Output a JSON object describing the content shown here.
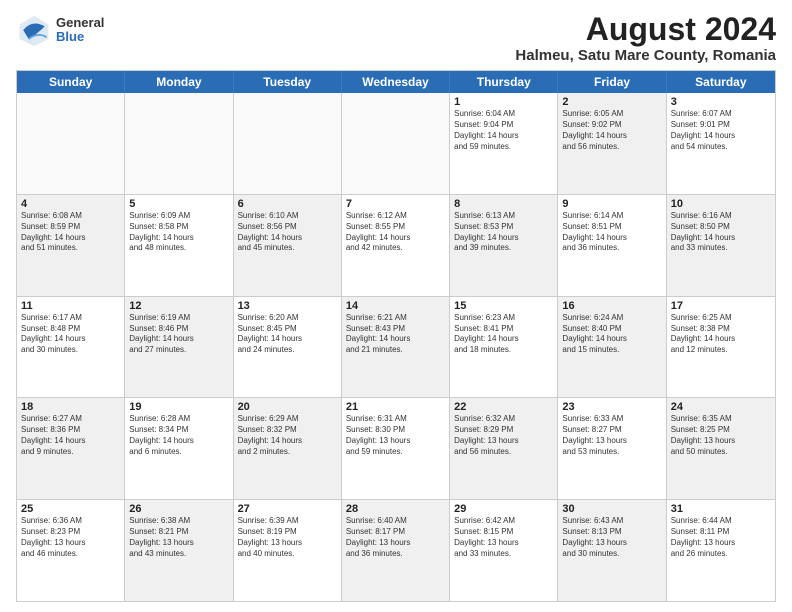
{
  "header": {
    "logo": {
      "general": "General",
      "blue": "Blue"
    },
    "title": "August 2024",
    "subtitle": "Halmeu, Satu Mare County, Romania"
  },
  "calendar": {
    "days_of_week": [
      "Sunday",
      "Monday",
      "Tuesday",
      "Wednesday",
      "Thursday",
      "Friday",
      "Saturday"
    ],
    "rows": [
      [
        {
          "day": "",
          "info": "",
          "shaded": false,
          "empty": true
        },
        {
          "day": "",
          "info": "",
          "shaded": false,
          "empty": true
        },
        {
          "day": "",
          "info": "",
          "shaded": false,
          "empty": true
        },
        {
          "day": "",
          "info": "",
          "shaded": false,
          "empty": true
        },
        {
          "day": "1",
          "info": "Sunrise: 6:04 AM\nSunset: 9:04 PM\nDaylight: 14 hours\nand 59 minutes.",
          "shaded": false,
          "empty": false
        },
        {
          "day": "2",
          "info": "Sunrise: 6:05 AM\nSunset: 9:02 PM\nDaylight: 14 hours\nand 56 minutes.",
          "shaded": true,
          "empty": false
        },
        {
          "day": "3",
          "info": "Sunrise: 6:07 AM\nSunset: 9:01 PM\nDaylight: 14 hours\nand 54 minutes.",
          "shaded": false,
          "empty": false
        }
      ],
      [
        {
          "day": "4",
          "info": "Sunrise: 6:08 AM\nSunset: 8:59 PM\nDaylight: 14 hours\nand 51 minutes.",
          "shaded": true,
          "empty": false
        },
        {
          "day": "5",
          "info": "Sunrise: 6:09 AM\nSunset: 8:58 PM\nDaylight: 14 hours\nand 48 minutes.",
          "shaded": false,
          "empty": false
        },
        {
          "day": "6",
          "info": "Sunrise: 6:10 AM\nSunset: 8:56 PM\nDaylight: 14 hours\nand 45 minutes.",
          "shaded": true,
          "empty": false
        },
        {
          "day": "7",
          "info": "Sunrise: 6:12 AM\nSunset: 8:55 PM\nDaylight: 14 hours\nand 42 minutes.",
          "shaded": false,
          "empty": false
        },
        {
          "day": "8",
          "info": "Sunrise: 6:13 AM\nSunset: 8:53 PM\nDaylight: 14 hours\nand 39 minutes.",
          "shaded": true,
          "empty": false
        },
        {
          "day": "9",
          "info": "Sunrise: 6:14 AM\nSunset: 8:51 PM\nDaylight: 14 hours\nand 36 minutes.",
          "shaded": false,
          "empty": false
        },
        {
          "day": "10",
          "info": "Sunrise: 6:16 AM\nSunset: 8:50 PM\nDaylight: 14 hours\nand 33 minutes.",
          "shaded": true,
          "empty": false
        }
      ],
      [
        {
          "day": "11",
          "info": "Sunrise: 6:17 AM\nSunset: 8:48 PM\nDaylight: 14 hours\nand 30 minutes.",
          "shaded": false,
          "empty": false
        },
        {
          "day": "12",
          "info": "Sunrise: 6:19 AM\nSunset: 8:46 PM\nDaylight: 14 hours\nand 27 minutes.",
          "shaded": true,
          "empty": false
        },
        {
          "day": "13",
          "info": "Sunrise: 6:20 AM\nSunset: 8:45 PM\nDaylight: 14 hours\nand 24 minutes.",
          "shaded": false,
          "empty": false
        },
        {
          "day": "14",
          "info": "Sunrise: 6:21 AM\nSunset: 8:43 PM\nDaylight: 14 hours\nand 21 minutes.",
          "shaded": true,
          "empty": false
        },
        {
          "day": "15",
          "info": "Sunrise: 6:23 AM\nSunset: 8:41 PM\nDaylight: 14 hours\nand 18 minutes.",
          "shaded": false,
          "empty": false
        },
        {
          "day": "16",
          "info": "Sunrise: 6:24 AM\nSunset: 8:40 PM\nDaylight: 14 hours\nand 15 minutes.",
          "shaded": true,
          "empty": false
        },
        {
          "day": "17",
          "info": "Sunrise: 6:25 AM\nSunset: 8:38 PM\nDaylight: 14 hours\nand 12 minutes.",
          "shaded": false,
          "empty": false
        }
      ],
      [
        {
          "day": "18",
          "info": "Sunrise: 6:27 AM\nSunset: 8:36 PM\nDaylight: 14 hours\nand 9 minutes.",
          "shaded": true,
          "empty": false
        },
        {
          "day": "19",
          "info": "Sunrise: 6:28 AM\nSunset: 8:34 PM\nDaylight: 14 hours\nand 6 minutes.",
          "shaded": false,
          "empty": false
        },
        {
          "day": "20",
          "info": "Sunrise: 6:29 AM\nSunset: 8:32 PM\nDaylight: 14 hours\nand 2 minutes.",
          "shaded": true,
          "empty": false
        },
        {
          "day": "21",
          "info": "Sunrise: 6:31 AM\nSunset: 8:30 PM\nDaylight: 13 hours\nand 59 minutes.",
          "shaded": false,
          "empty": false
        },
        {
          "day": "22",
          "info": "Sunrise: 6:32 AM\nSunset: 8:29 PM\nDaylight: 13 hours\nand 56 minutes.",
          "shaded": true,
          "empty": false
        },
        {
          "day": "23",
          "info": "Sunrise: 6:33 AM\nSunset: 8:27 PM\nDaylight: 13 hours\nand 53 minutes.",
          "shaded": false,
          "empty": false
        },
        {
          "day": "24",
          "info": "Sunrise: 6:35 AM\nSunset: 8:25 PM\nDaylight: 13 hours\nand 50 minutes.",
          "shaded": true,
          "empty": false
        }
      ],
      [
        {
          "day": "25",
          "info": "Sunrise: 6:36 AM\nSunset: 8:23 PM\nDaylight: 13 hours\nand 46 minutes.",
          "shaded": false,
          "empty": false
        },
        {
          "day": "26",
          "info": "Sunrise: 6:38 AM\nSunset: 8:21 PM\nDaylight: 13 hours\nand 43 minutes.",
          "shaded": true,
          "empty": false
        },
        {
          "day": "27",
          "info": "Sunrise: 6:39 AM\nSunset: 8:19 PM\nDaylight: 13 hours\nand 40 minutes.",
          "shaded": false,
          "empty": false
        },
        {
          "day": "28",
          "info": "Sunrise: 6:40 AM\nSunset: 8:17 PM\nDaylight: 13 hours\nand 36 minutes.",
          "shaded": true,
          "empty": false
        },
        {
          "day": "29",
          "info": "Sunrise: 6:42 AM\nSunset: 8:15 PM\nDaylight: 13 hours\nand 33 minutes.",
          "shaded": false,
          "empty": false
        },
        {
          "day": "30",
          "info": "Sunrise: 6:43 AM\nSunset: 8:13 PM\nDaylight: 13 hours\nand 30 minutes.",
          "shaded": true,
          "empty": false
        },
        {
          "day": "31",
          "info": "Sunrise: 6:44 AM\nSunset: 8:11 PM\nDaylight: 13 hours\nand 26 minutes.",
          "shaded": false,
          "empty": false
        }
      ]
    ]
  }
}
